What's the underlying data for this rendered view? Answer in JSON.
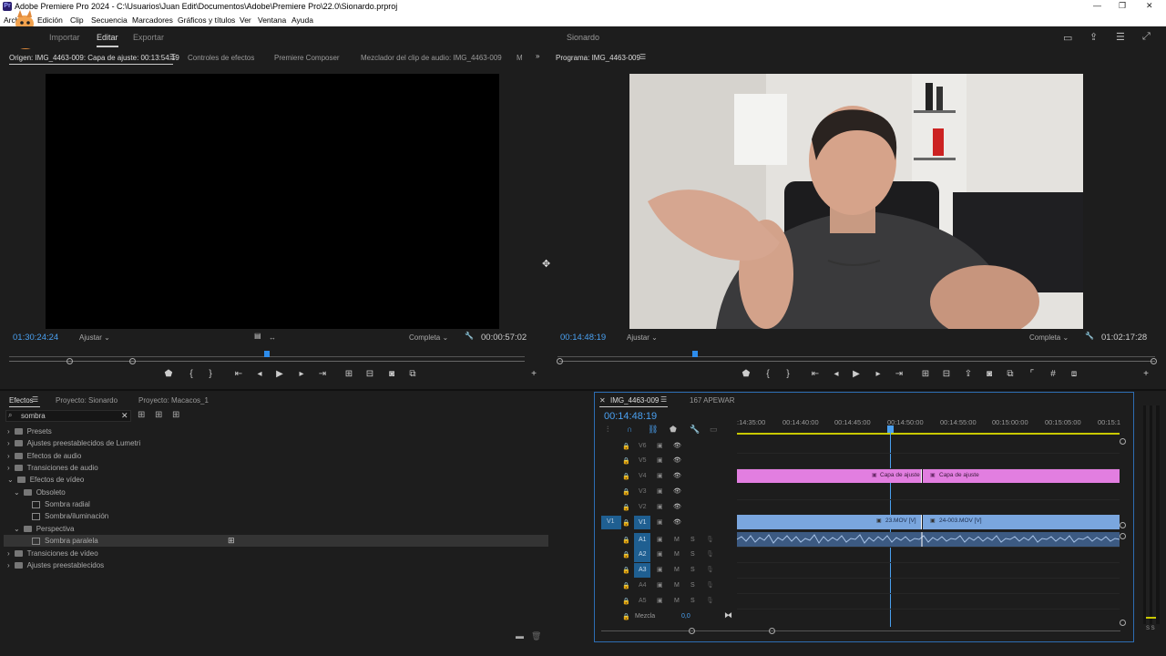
{
  "window": {
    "title": "Adobe Premiere Pro 2024 - C:\\Usuarios\\Juan Edit\\Documentos\\Adobe\\Premiere Pro\\22.0\\Sionardo.prproj",
    "minimize": "—",
    "maximize": "❐",
    "close": "✕",
    "app_icon": "Pr"
  },
  "menu": [
    "Archivo",
    "Edición",
    "Clip",
    "Secuencia",
    "Marcadores",
    "Gráficos y títulos",
    "Ver",
    "Ventana",
    "Ayuda"
  ],
  "workspace": {
    "tabs": [
      "Importar",
      "Editar",
      "Exportar"
    ],
    "active": "Editar",
    "project_name": "Sionardo"
  },
  "source_panel": {
    "tabs": [
      "Origen: IMG_4463-009: Capa de ajuste: 00:13:54:19",
      "Controles de efectos",
      "Premiere Composer",
      "Mezclador del clip de audio: IMG_4463-009",
      "M"
    ],
    "overflow": "»",
    "timecode": "01:30:24:24",
    "fit": "Ajustar",
    "quality": "Completa",
    "duration": "00:00:57:02",
    "playhead_fraction": 0.5
  },
  "program_panel": {
    "title": "Programa: IMG_4463-009",
    "timecode": "00:14:48:19",
    "fit": "Ajustar",
    "quality": "Completa",
    "duration": "01:02:17:28",
    "playhead_fraction": 0.23
  },
  "effects_panel": {
    "tabs": [
      "Efectos",
      "Proyecto: Sionardo",
      "Proyecto: Macacos_1"
    ],
    "search_value": "sombra",
    "tree": [
      {
        "label": "Presets",
        "level": 0,
        "type": "folder",
        "open": false
      },
      {
        "label": "Ajustes preestablecidos de Lumetri",
        "level": 0,
        "type": "folder",
        "open": false
      },
      {
        "label": "Efectos de audio",
        "level": 0,
        "type": "folder",
        "open": false
      },
      {
        "label": "Transiciones de audio",
        "level": 0,
        "type": "folder",
        "open": false
      },
      {
        "label": "Efectos de vídeo",
        "level": 0,
        "type": "folder",
        "open": true
      },
      {
        "label": "Obsoleto",
        "level": 1,
        "type": "folder",
        "open": true
      },
      {
        "label": "Sombra radial",
        "level": 2,
        "type": "fx"
      },
      {
        "label": "Sombra/iluminación",
        "level": 2,
        "type": "fx"
      },
      {
        "label": "Perspectiva",
        "level": 1,
        "type": "folder",
        "open": true
      },
      {
        "label": "Sombra paralela",
        "level": 2,
        "type": "fx",
        "selected": true
      },
      {
        "label": "Transiciones de vídeo",
        "level": 0,
        "type": "folder",
        "open": false
      },
      {
        "label": "Ajustes preestablecidos",
        "level": 0,
        "type": "folder",
        "open": false
      }
    ]
  },
  "timeline": {
    "tabs": [
      "IMG_4463-009",
      "167 APEWAR"
    ],
    "timecode": "00:14:48:19",
    "ruler_labels": [
      ":14:35:00",
      "00:14:40:00",
      "00:14:45:00",
      "00:14:50:00",
      "00:14:55:00",
      "00:15:00:00",
      "00:15:05:00",
      "00:15:1"
    ],
    "video_tracks": [
      "V6",
      "V5",
      "V4",
      "V3",
      "V2",
      "V1"
    ],
    "audio_tracks": [
      "A1",
      "A2",
      "A3",
      "A4",
      "A5"
    ],
    "source_patch": "V1",
    "mix_label": "Mezcla",
    "mix_value": "0,0",
    "clips": {
      "adjust_a": "Capa de ajuste",
      "adjust_b": "Capa de ajuste",
      "video_a": "23.MOV [V]",
      "video_b": "24-003.MOV [V]"
    },
    "m": "M",
    "s": "S"
  },
  "meter": {
    "label": "S S"
  },
  "colors": {
    "accent": "#2d8ceb",
    "adjust_clip": "#e27ee0",
    "video_clip": "#7aa6de",
    "playhead": "#4aa0f0"
  }
}
